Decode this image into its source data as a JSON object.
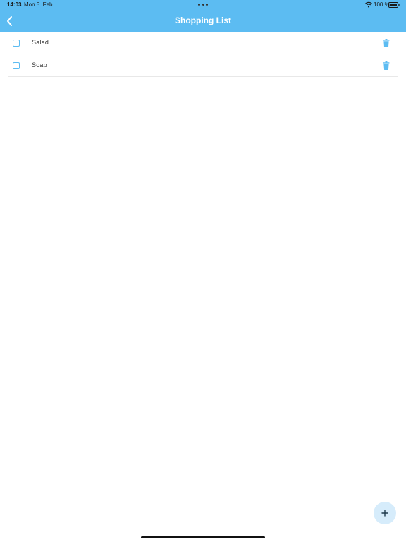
{
  "status_bar": {
    "time": "14:03",
    "date": "Mon 5. Feb",
    "battery_percent": "100 %",
    "icons": [
      "wifi-icon",
      "battery-icon"
    ]
  },
  "header": {
    "title": "Shopping List",
    "back_icon": "chevron-left-icon"
  },
  "list": {
    "items": [
      {
        "label": "Salad",
        "checked": false
      },
      {
        "label": "Soap",
        "checked": false
      }
    ]
  },
  "fab": {
    "label": "+",
    "icon": "plus-icon"
  },
  "colors": {
    "accent": "#5cbcf2",
    "fab_background": "#d6ecfb",
    "text": "#333333",
    "divider": "#e8e8e8"
  }
}
